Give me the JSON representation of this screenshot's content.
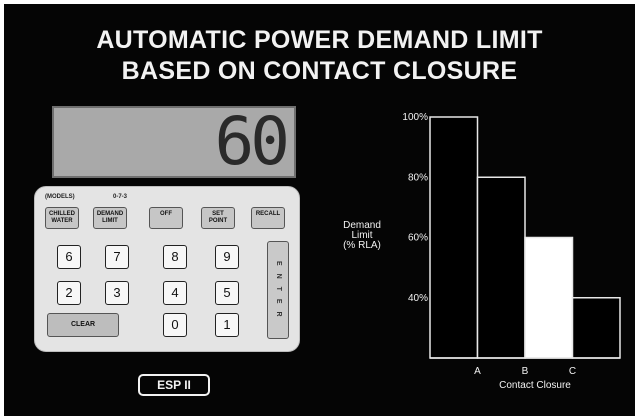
{
  "title_line1": "AUTOMATIC POWER DEMAND LIMIT",
  "title_line2": "BASED ON CONTACT CLOSURE",
  "device": {
    "display_value": "60",
    "top_labels": [
      "(MODELS)",
      "0-7-3"
    ],
    "function_keys": [
      "CHILLED\nWATER",
      "DEMAND\nLIMIT",
      "OFF",
      "SET\nPOINT",
      "RECALL"
    ],
    "number_rows": [
      [
        "6",
        "7",
        "8",
        "9"
      ],
      [
        "2",
        "3",
        "4",
        "5"
      ],
      [
        "0",
        "1"
      ]
    ],
    "clear_label": "CLEAR",
    "enter_label": "E N T E R",
    "name": "ESP II"
  },
  "chart_data": {
    "type": "bar",
    "title": "",
    "categories": [
      "A",
      "B",
      "C"
    ],
    "bars": [
      {
        "label": "",
        "value": 100
      },
      {
        "label": "A",
        "value": 80
      },
      {
        "label": "B",
        "value": 60
      },
      {
        "label": "C",
        "value": 40
      }
    ],
    "highlight_index": 2,
    "colors": {
      "bar": "#000000",
      "bar_outline": "#e8e8e8",
      "highlight": "#ffffff"
    },
    "yticks": [
      "100%",
      "80%",
      "60%",
      "40%"
    ],
    "ytick_values": [
      100,
      80,
      60,
      40
    ],
    "ylim": [
      20,
      100
    ],
    "ylabel": "Demand\nLimit\n(% RLA)",
    "xlabel": "Contact Closure"
  }
}
